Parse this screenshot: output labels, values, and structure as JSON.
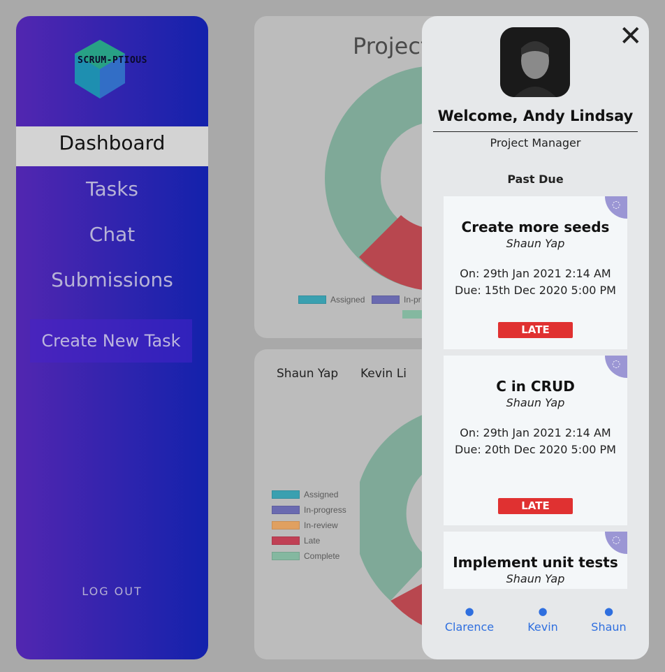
{
  "sidebar": {
    "logo_text": "SCRUM-PTIOUS",
    "nav": [
      "Dashboard",
      "Tasks",
      "Chat",
      "Submissions"
    ],
    "active": "Dashboard",
    "create_label": "Create New Task",
    "logout_label": "LOG OUT"
  },
  "card1": {
    "title": "Project",
    "legend": [
      {
        "label": "Assigned",
        "color": "#3aa0b0"
      },
      {
        "label": "In-pr",
        "color": "#6a6ab0"
      }
    ]
  },
  "card2": {
    "members": [
      "Shaun Yap",
      "Kevin Li"
    ],
    "legend": [
      {
        "label": "Assigned",
        "color": "#3aa0b0"
      },
      {
        "label": "In-progress",
        "color": "#6a6ab0"
      },
      {
        "label": "In-review",
        "color": "#e0a060"
      },
      {
        "label": "Late",
        "color": "#c04055"
      },
      {
        "label": "Complete",
        "color": "#84b8a0"
      }
    ]
  },
  "panel": {
    "close_label": "✕",
    "welcome": "Welcome, Andy Lindsay",
    "role": "Project Manager",
    "section": "Past Due",
    "tasks": [
      {
        "title": "Create more seeds",
        "owner": "Shaun Yap",
        "on": "On: 29th Jan 2021 2:14 AM",
        "due": "Due: 15th Dec 2020 5:00 PM",
        "status": "LATE"
      },
      {
        "title": "C in CRUD",
        "owner": "Shaun Yap",
        "on": "On: 29th Jan 2021 2:14 AM",
        "due": "Due: 20th Dec 2020 5:00 PM",
        "status": "LATE"
      },
      {
        "title": "Implement unit tests",
        "owner": "Shaun Yap"
      }
    ],
    "footer": [
      "Clarence",
      "Kevin",
      "Shaun"
    ]
  },
  "colors": {
    "accent_late": "#e03131",
    "link": "#2f6fdf",
    "sidebar_start": "#5226b0",
    "sidebar_end": "#1322ac"
  }
}
